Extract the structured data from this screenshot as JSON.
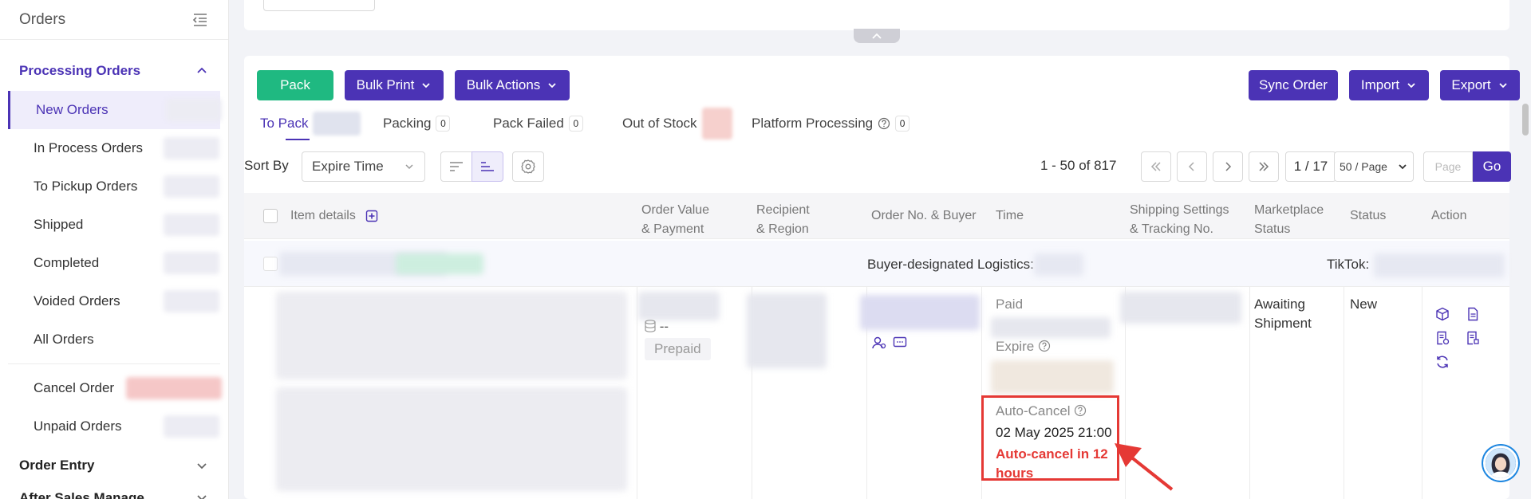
{
  "sidebar": {
    "title": "Orders",
    "groups": [
      {
        "label": "Processing Orders"
      },
      {
        "label": "Order Entry"
      },
      {
        "label": "After Sales Manage"
      }
    ],
    "items": [
      {
        "label": "New Orders"
      },
      {
        "label": "In Process Orders"
      },
      {
        "label": "To Pickup Orders"
      },
      {
        "label": "Shipped"
      },
      {
        "label": "Completed"
      },
      {
        "label": "Voided Orders"
      },
      {
        "label": "All Orders"
      },
      {
        "label": "Cancel Order"
      },
      {
        "label": "Unpaid Orders"
      }
    ]
  },
  "toolbar": {
    "pack": "Pack",
    "bulk_print": "Bulk Print",
    "bulk_actions": "Bulk Actions",
    "sync_order": "Sync Order",
    "import": "Import",
    "export": "Export"
  },
  "tabs": [
    {
      "label": "To Pack"
    },
    {
      "label": "Packing",
      "count": "0"
    },
    {
      "label": "Pack Failed",
      "count": "0"
    },
    {
      "label": "Out of Stock"
    },
    {
      "label": "Platform Processing",
      "count": "0"
    }
  ],
  "sort": {
    "label": "Sort By",
    "value": "Expire Time"
  },
  "pager": {
    "range": "1 - 50 of 817",
    "page": "1 / 17",
    "page_size": "50 / Page",
    "page_placeholder": "Page",
    "go": "Go"
  },
  "table": {
    "headers": {
      "item_details": "Item details",
      "order_value_1": "Order Value",
      "order_value_2": "& Payment",
      "recipient_1": "Recipient",
      "recipient_2": "& Region",
      "order_no": "Order No. & Buyer",
      "time": "Time",
      "shipping_1": "Shipping Settings",
      "shipping_2": "& Tracking No.",
      "marketplace_1": "Marketplace",
      "marketplace_2": "Status",
      "status": "Status",
      "action": "Action"
    },
    "group": {
      "logistics_label": "Buyer-designated Logistics:",
      "platform_label": "TikTok:"
    },
    "row": {
      "payment_value": "--",
      "payment_tag": "Prepaid",
      "paid_label": "Paid",
      "expire_label": "Expire",
      "auto_cancel_label": "Auto-Cancel",
      "auto_cancel_time": "02 May 2025 21:00",
      "auto_cancel_warning_1": "Auto-cancel in 12",
      "auto_cancel_warning_2": "hours",
      "marketplace_status_1": "Awaiting",
      "marketplace_status_2": "Shipment",
      "status": "New"
    }
  },
  "colors": {
    "accent": "#4b33b5",
    "green": "#1fb981",
    "warning": "#e53935"
  }
}
